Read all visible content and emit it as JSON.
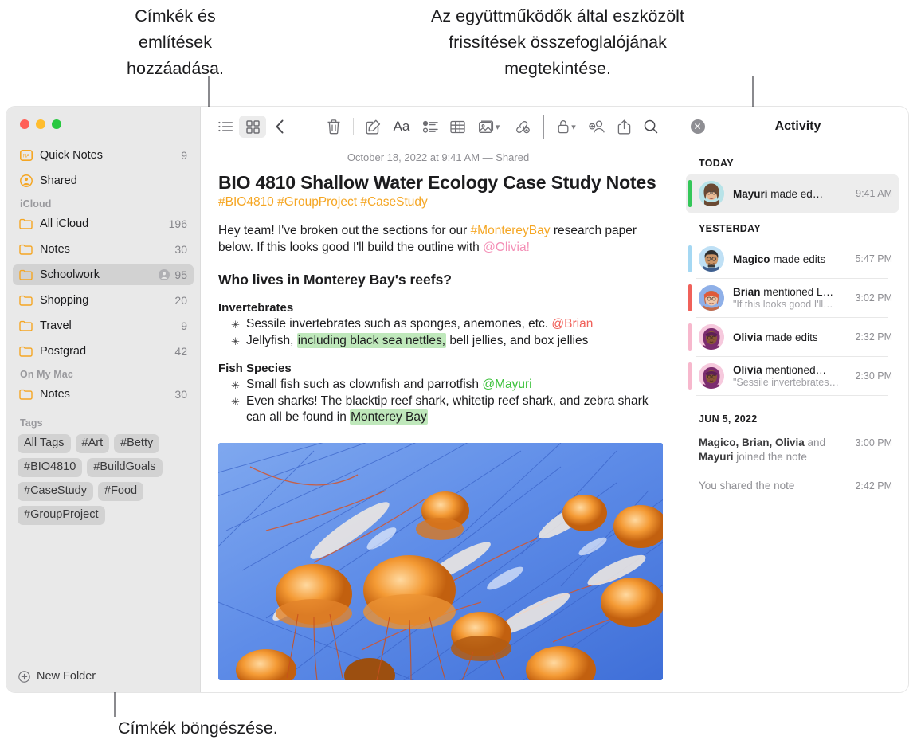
{
  "annotations": {
    "top_left": "Címkék és\nemlítések\nhozzáadása.",
    "top_right": "Az együttműködők által eszközölt\nfrissítések összefoglalójának\nmegtekintése.",
    "bottom_left": "Címkék böngészése."
  },
  "sidebar": {
    "top_items": [
      {
        "label": "Quick Notes",
        "count": "9",
        "icon": "quick-note-icon"
      },
      {
        "label": "Shared",
        "count": "",
        "icon": "shared-person-icon"
      }
    ],
    "sections": [
      {
        "title": "iCloud",
        "items": [
          {
            "label": "All iCloud",
            "count": "196",
            "icon": "folder-icon",
            "selected": false,
            "shared": false
          },
          {
            "label": "Notes",
            "count": "30",
            "icon": "folder-icon",
            "selected": false,
            "shared": false
          },
          {
            "label": "Schoolwork",
            "count": "95",
            "icon": "folder-icon",
            "selected": true,
            "shared": true
          },
          {
            "label": "Shopping",
            "count": "20",
            "icon": "folder-icon",
            "selected": false,
            "shared": false
          },
          {
            "label": "Travel",
            "count": "9",
            "icon": "folder-icon",
            "selected": false,
            "shared": false
          },
          {
            "label": "Postgrad",
            "count": "42",
            "icon": "folder-icon",
            "selected": false,
            "shared": false
          }
        ]
      },
      {
        "title": "On My Mac",
        "items": [
          {
            "label": "Notes",
            "count": "30",
            "icon": "folder-icon",
            "selected": false,
            "shared": false
          }
        ]
      }
    ],
    "tags_section_title": "Tags",
    "tags": [
      "All Tags",
      "#Art",
      "#Betty",
      "#BIO4810",
      "#BuildGoals",
      "#CaseStudy",
      "#Food",
      "#GroupProject"
    ],
    "new_folder_label": "New Folder"
  },
  "toolbar": {
    "left_buttons": [
      {
        "name": "list-view-icon",
        "label": "List View"
      },
      {
        "name": "gallery-view-icon",
        "label": "Gallery View"
      },
      {
        "name": "back-chevron-icon",
        "label": "Back"
      }
    ],
    "right_buttons": [
      {
        "name": "trash-icon",
        "label": "Delete"
      },
      {
        "name": "compose-icon",
        "label": "New Note"
      },
      {
        "name": "format-icon",
        "label": "Aa"
      },
      {
        "name": "checklist-icon",
        "label": "Checklist"
      },
      {
        "name": "table-icon",
        "label": "Table"
      },
      {
        "name": "media-icon",
        "label": "Media"
      },
      {
        "name": "link-icon",
        "label": "Link"
      },
      {
        "name": "lock-icon",
        "label": "Lock"
      },
      {
        "name": "add-people-icon",
        "label": "Collaborate"
      },
      {
        "name": "share-icon",
        "label": "Share"
      },
      {
        "name": "search-icon",
        "label": "Search"
      }
    ]
  },
  "note": {
    "date_line": "October 18, 2022 at 9:41 AM — Shared",
    "title": "BIO 4810 Shallow Water Ecology Case Study Notes",
    "tags_line": "#BIO4810 #GroupProject #CaseStudy",
    "intro_a": "Hey team! I've broken out the sections for our ",
    "intro_tag": "#MontereyBay",
    "intro_b": " research paper below. If this looks good I'll build the outline with ",
    "intro_mention": "@Olivia!",
    "heading": "Who lives in Monterey Bay's reefs?",
    "sub1": "Invertebrates",
    "b1_a": "Sessile invertebrates such as sponges, anemones, etc. ",
    "b1_mention": "@Brian",
    "b2_a": "Jellyfish, ",
    "b2_hl": "including black sea nettles,",
    "b2_b": " bell jellies, and box jellies",
    "sub2": "Fish Species",
    "b3_a": "Small fish such as clownfish and parrotfish ",
    "b3_mention": "@Mayuri",
    "b4_a": "Even sharks! The blacktip reef shark, whitetip reef shark, and zebra shark can all be found in ",
    "b4_hl": "Monterey Bay",
    "image_alt": "jellyfish-photo"
  },
  "activity": {
    "title": "Activity",
    "close_icon": "close-icon",
    "groups": [
      {
        "header": "TODAY",
        "rows": [
          {
            "name": "Mayuri",
            "action": " made ed…",
            "quote": "",
            "time": "9:41 AM",
            "bar_color": "#34c759",
            "avatar_bg": "#b8e3e8",
            "avatar_hair": "#6b4a33",
            "avatar_skin": "#e8bb96",
            "selected": true
          }
        ]
      },
      {
        "header": "YESTERDAY",
        "rows": [
          {
            "name": "Magico",
            "action": " made edits",
            "quote": "",
            "time": "5:47 PM",
            "bar_color": "#a5d8f3",
            "avatar_bg": "#bfe0f5",
            "avatar_hair": "#2e2e2e",
            "avatar_skin": "#c99366",
            "selected": false
          },
          {
            "name": "Brian",
            "action": " mentioned L…",
            "quote": "\"If this looks good I'll…",
            "time": "3:02 PM",
            "bar_color": "#f0615a",
            "avatar_bg": "#8fb0e8",
            "avatar_hair": "#c8492e",
            "avatar_skin": "#eec6a8",
            "selected": false
          },
          {
            "name": "Olivia",
            "action": " made edits",
            "quote": "",
            "time": "2:32 PM",
            "bar_color": "#f7b8cd",
            "avatar_bg": "#f6c9dd",
            "avatar_hair": "#7b2c6e",
            "avatar_skin": "#8a5636",
            "selected": false
          },
          {
            "name": "Olivia",
            "action": " mentioned…",
            "quote": "\"Sessile invertebrates…",
            "time": "2:30 PM",
            "bar_color": "#f7b8cd",
            "avatar_bg": "#f6c9dd",
            "avatar_hair": "#7b2c6e",
            "avatar_skin": "#8a5636",
            "selected": false
          }
        ]
      }
    ],
    "old_header": "JUN 5, 2022",
    "old_rows": [
      {
        "bold": "Magico, Brian, Olivia",
        "rest": " and ",
        "bold2": "Mayuri",
        "rest2": " joined the note",
        "time": "3:00 PM"
      },
      {
        "bold": "",
        "rest": "You shared the note",
        "bold2": "",
        "rest2": "",
        "time": "2:42 PM"
      }
    ]
  },
  "colors": {
    "accent_orange": "#f5a623",
    "highlight_green": "#bfe8bb",
    "sidebar_bg": "#e9e9e9",
    "selected_row": "#d2d2d2"
  }
}
